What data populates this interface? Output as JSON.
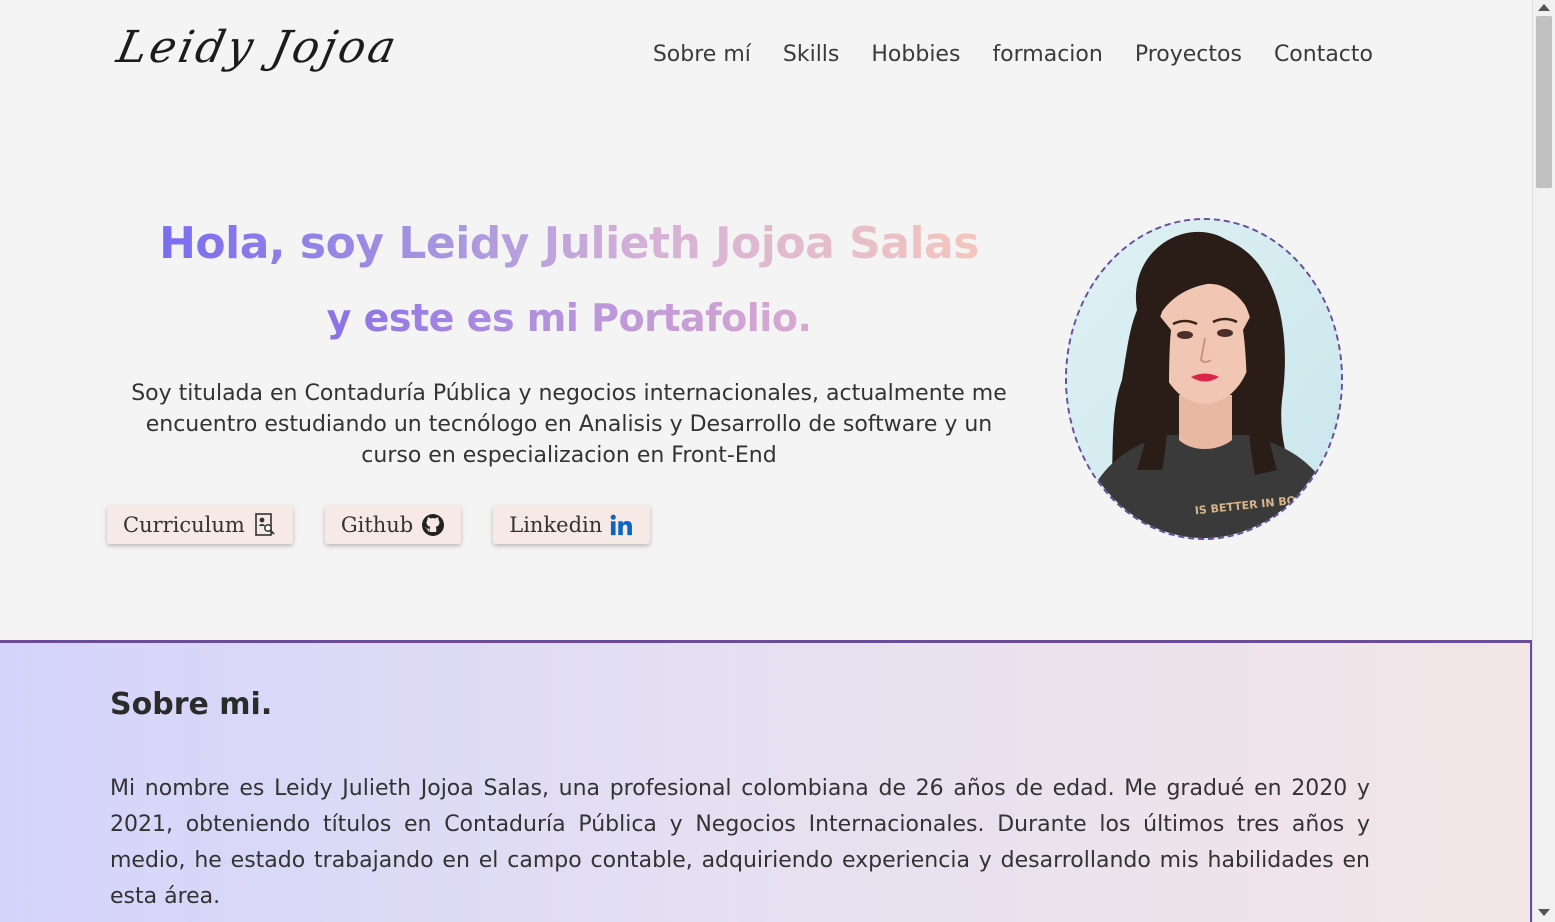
{
  "header": {
    "logo_text": "Leidy Jojoa",
    "nav": [
      {
        "label": "Sobre mí"
      },
      {
        "label": "Skills"
      },
      {
        "label": "Hobbies"
      },
      {
        "label": "formacion"
      },
      {
        "label": "Proyectos"
      },
      {
        "label": "Contacto"
      }
    ]
  },
  "hero": {
    "title_line1": "Hola, soy Leidy Julieth Jojoa Salas",
    "title_line2": "y este es mi Portafolio.",
    "intro": "Soy titulada en Contaduría Pública y negocios internacionales, actualmente me encuentro estudiando un tecnólogo en Analisis y Desarrollo de software y un curso en especializacion en Front-End",
    "buttons": [
      {
        "label": "Curriculum",
        "icon": "document-search-icon"
      },
      {
        "label": "Github",
        "icon": "github-icon"
      },
      {
        "label": "Linkedin",
        "icon": "linkedin-icon"
      }
    ],
    "gradient_colors": [
      "#7a6cf0",
      "#a796de",
      "#d5b1d8",
      "#f3c6bd"
    ]
  },
  "about": {
    "heading": "Sobre mi.",
    "paragraph": "Mi nombre es Leidy Julieth Jojoa Salas, una profesional colombiana de 26 años de edad. Me gradué en 2020 y 2021, obteniendo títulos en Contaduría Pública y Negocios Internacionales. Durante los últimos tres años y medio, he estado trabajando en el campo contable, adquiriendo experiencia y desarrollando mis habilidades en esta área.",
    "accent_color": "#6b4c9a"
  }
}
